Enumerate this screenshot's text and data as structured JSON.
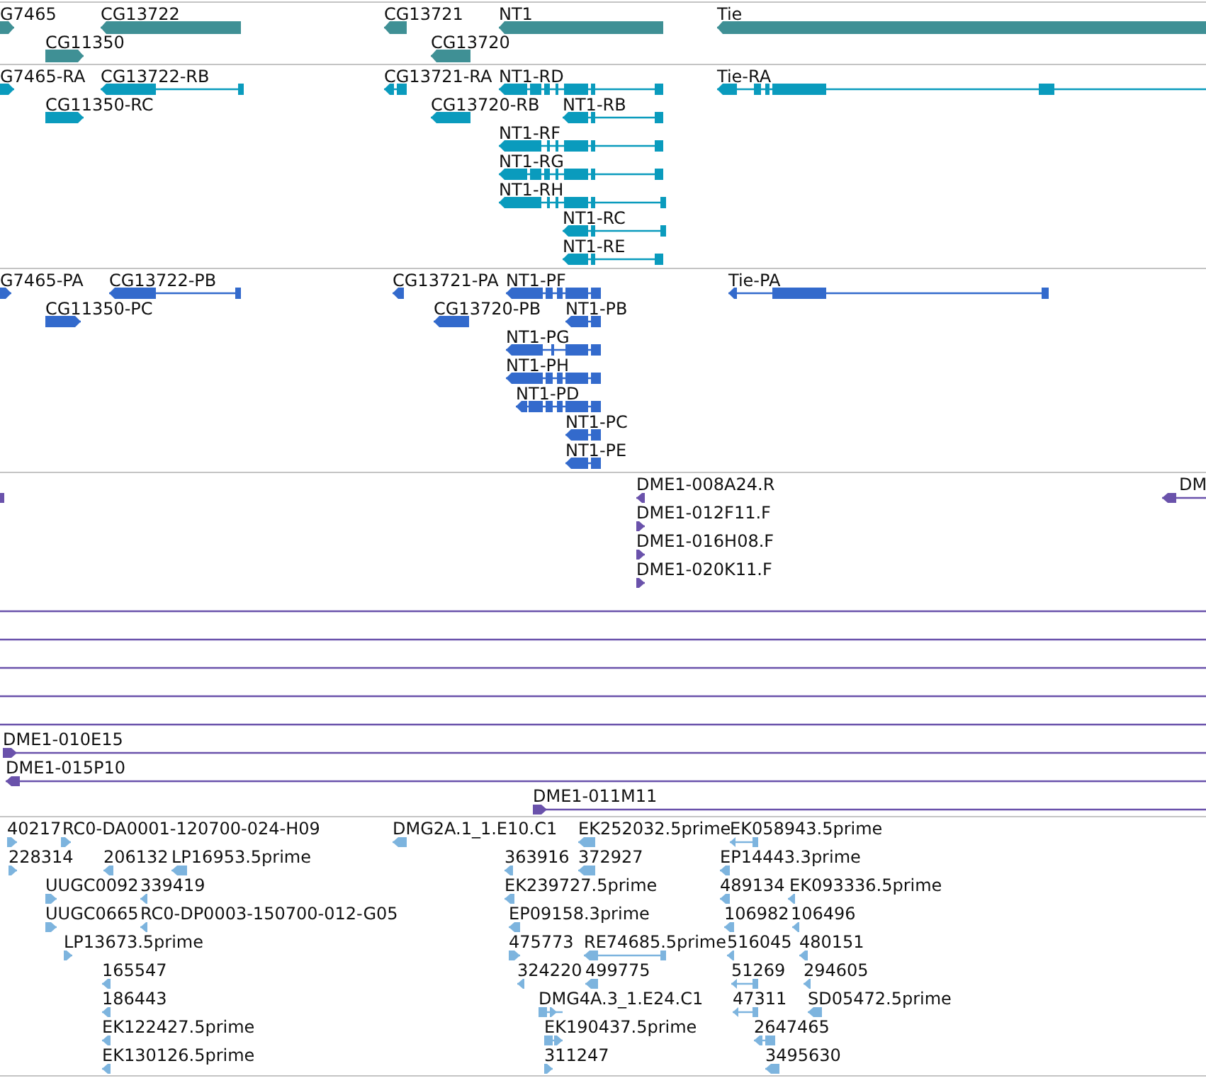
{
  "tracks": [
    {
      "kind": "gene",
      "color": "#3f9095",
      "features": [
        {
          "label": "G7465",
          "reverse": false
        },
        {
          "label": "CG13722",
          "reverse": true
        },
        {
          "label": "CG11350",
          "reverse": false
        },
        {
          "label": "CG13721",
          "reverse": true
        },
        {
          "label": "NT1",
          "reverse": true
        },
        {
          "label": "CG13720",
          "reverse": true
        },
        {
          "label": "Tie",
          "reverse": true
        }
      ]
    },
    {
      "kind": "transcript",
      "color": "#0a9bbd",
      "features": [
        {
          "label": "G7465-RA",
          "reverse": false
        },
        {
          "label": "CG13722-RB",
          "reverse": true
        },
        {
          "label": "CG11350-RC",
          "reverse": false
        },
        {
          "label": "CG13721-RA",
          "reverse": true
        },
        {
          "label": "NT1-RD",
          "reverse": true
        },
        {
          "label": "CG13720-RB",
          "reverse": true
        },
        {
          "label": "NT1-RB",
          "reverse": true
        },
        {
          "label": "NT1-RF",
          "reverse": true
        },
        {
          "label": "NT1-RG",
          "reverse": true
        },
        {
          "label": "NT1-RH",
          "reverse": true
        },
        {
          "label": "NT1-RC",
          "reverse": true
        },
        {
          "label": "NT1-RE",
          "reverse": true
        },
        {
          "label": "Tie-RA",
          "reverse": true
        }
      ]
    },
    {
      "kind": "protein",
      "color": "#336acc",
      "features": [
        {
          "label": "G7465-PA",
          "reverse": false
        },
        {
          "label": "CG13722-PB",
          "reverse": true
        },
        {
          "label": "CG11350-PC",
          "reverse": false
        },
        {
          "label": "CG13721-PA",
          "reverse": true
        },
        {
          "label": "NT1-PF",
          "reverse": true
        },
        {
          "label": "CG13720-PB",
          "reverse": true
        },
        {
          "label": "NT1-PB",
          "reverse": true
        },
        {
          "label": "NT1-PG",
          "reverse": true
        },
        {
          "label": "NT1-PH",
          "reverse": true
        },
        {
          "label": "NT1-PD",
          "reverse": true
        },
        {
          "label": "NT1-PC",
          "reverse": true
        },
        {
          "label": "NT1-PE",
          "reverse": true
        },
        {
          "label": "Tie-PA",
          "reverse": true
        }
      ]
    },
    {
      "kind": "clone",
      "color": "#6a52ab",
      "features": [
        {
          "kind": "line"
        },
        {
          "kind": "arrow",
          "label": "DME1-008A24.R",
          "reverse": true
        },
        {
          "kind": "arrow",
          "label": "DM",
          "reverse": true
        },
        {
          "kind": "arrow",
          "label": "DME1-012F11.F",
          "reverse": false
        },
        {
          "kind": "arrow",
          "label": "DME1-016H08.F",
          "reverse": false
        },
        {
          "kind": "arrow",
          "label": "DME1-020K11.F",
          "reverse": false
        },
        {
          "kind": "line"
        },
        {
          "kind": "line"
        },
        {
          "kind": "line"
        },
        {
          "kind": "line"
        },
        {
          "kind": "line"
        },
        {
          "kind": "arrow",
          "label": "DME1-010E15",
          "reverse": false
        },
        {
          "kind": "arrow",
          "label": "DME1-015P10",
          "reverse": true
        },
        {
          "kind": "arrow",
          "label": "DME1-011M11",
          "reverse": false
        }
      ]
    },
    {
      "kind": "est",
      "color": "#7db4de",
      "features": [
        {
          "label": "40217",
          "reverse": false
        },
        {
          "label": "RC0-DA0001-120700-024-H09",
          "reverse": false
        },
        {
          "label": "DMG2A.1_1.E10.C1",
          "reverse": true
        },
        {
          "label": "EK252032.5prime",
          "reverse": true
        },
        {
          "label": "EK058943.5prime",
          "reverse": true
        },
        {
          "label": "228314",
          "reverse": false
        },
        {
          "label": "206132",
          "reverse": true
        },
        {
          "label": "LP16953.5prime",
          "reverse": true
        },
        {
          "label": "363916",
          "reverse": true
        },
        {
          "label": "372927",
          "reverse": true
        },
        {
          "label": "EP14443.3prime",
          "reverse": true
        },
        {
          "label": "UUGC0092",
          "reverse": false
        },
        {
          "label": "339419",
          "reverse": true
        },
        {
          "label": "EK239727.5prime",
          "reverse": true
        },
        {
          "label": "489134",
          "reverse": true
        },
        {
          "label": "EK093336.5prime",
          "reverse": true
        },
        {
          "label": "UUGC0665",
          "reverse": false
        },
        {
          "label": "RC0-DP0003-150700-012-G05",
          "reverse": true
        },
        {
          "label": "EP09158.3prime",
          "reverse": true
        },
        {
          "label": "106982",
          "reverse": true
        },
        {
          "label": "106496",
          "reverse": true
        },
        {
          "label": "LP13673.5prime",
          "reverse": false
        },
        {
          "label": "475773",
          "reverse": false
        },
        {
          "label": "RE74685.5prime",
          "reverse": true
        },
        {
          "label": "516045",
          "reverse": true
        },
        {
          "label": "480151",
          "reverse": true
        },
        {
          "label": "165547",
          "reverse": true
        },
        {
          "label": "324220",
          "reverse": true
        },
        {
          "label": "499775",
          "reverse": true
        },
        {
          "label": "51269",
          "reverse": true
        },
        {
          "label": "294605",
          "reverse": true
        },
        {
          "label": "186443",
          "reverse": true
        },
        {
          "label": "DMG4A.3_1.E24.C1",
          "reverse": false
        },
        {
          "label": "47311",
          "reverse": true
        },
        {
          "label": "SD05472.5prime",
          "reverse": true
        },
        {
          "label": "EK122427.5prime",
          "reverse": true
        },
        {
          "label": "EK190437.5prime",
          "reverse": false
        },
        {
          "label": "2647465",
          "reverse": true
        },
        {
          "label": "EK130126.5prime",
          "reverse": true
        },
        {
          "label": "311247",
          "reverse": false
        },
        {
          "label": "3495630",
          "reverse": true
        }
      ]
    }
  ]
}
